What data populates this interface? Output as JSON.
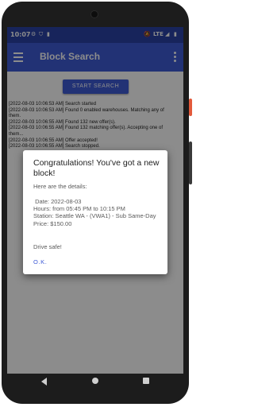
{
  "status_bar": {
    "time": "10:07",
    "network": "LTE"
  },
  "app_bar": {
    "title": "Block Search"
  },
  "main": {
    "start_button_label": "START SEARCH",
    "log": [
      "[2022-08-03 10:06:53 AM] Search started",
      "[2022-08-03 10:06:53 AM] Found 0 enabled warehouses. Matching any of them.",
      "[2022-08-03 10:06:55 AM] Found 132 new offer(s).",
      "[2022-08-03 10:06:55 AM] Found 132 matching offer(s). Accepting one of them...",
      "[2022-08-03 10:06:55 AM] Offer accepted!",
      "[2022-08-03 10:06:55 AM] Search stopped."
    ]
  },
  "dialog": {
    "title": "Congratulations! You've got a new block!",
    "intro": "Here are the details:",
    "details": [
      " Date: 2022-08-03",
      "Hours: from 05:45 PM to 10:15 PM",
      "Station: Seattle WA - (VWA1) - Sub Same-Day",
      "Price: $150.00"
    ],
    "outro": "Drive safe!",
    "ok_label": "O.K."
  },
  "colors": {
    "primary": "#3f5bd6",
    "status_bar": "#2a43a6",
    "power_button": "#e35a3b"
  }
}
